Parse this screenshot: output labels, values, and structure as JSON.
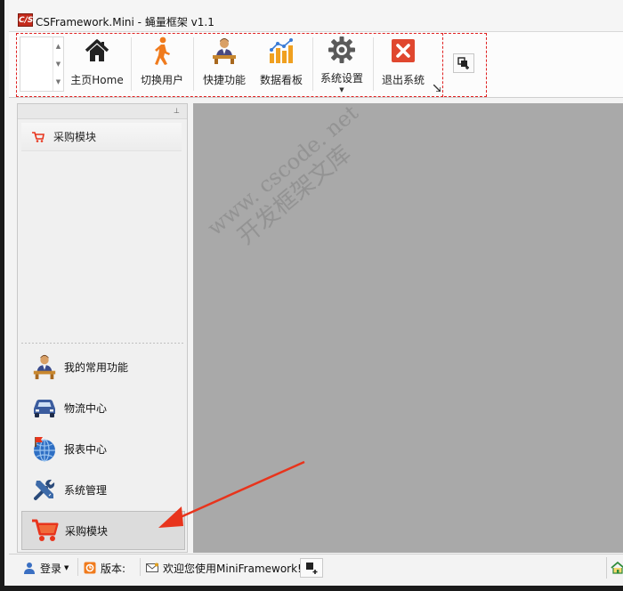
{
  "window": {
    "title": "CSFramework.Mini - 蝇量框架 v1.1",
    "logo_text": "C/S"
  },
  "ribbon": {
    "buttons": [
      {
        "label": "主页Home",
        "icon": "home-icon"
      },
      {
        "label": "切换用户",
        "icon": "walking-person-icon"
      },
      {
        "label": "快捷功能",
        "icon": "person-at-desk-icon"
      },
      {
        "label": "数据看板",
        "icon": "bar-chart-icon"
      },
      {
        "label": "系统设置",
        "icon": "gear-icon"
      },
      {
        "label": "退出系统",
        "icon": "close-icon"
      }
    ]
  },
  "nav": {
    "group_caption": "采购模块",
    "items": [
      {
        "label": "我的常用功能",
        "icon": "person-at-desk-icon"
      },
      {
        "label": "物流中心",
        "icon": "car-icon"
      },
      {
        "label": "报表中心",
        "icon": "globe-flag-icon"
      },
      {
        "label": "系统管理",
        "icon": "tools-icon"
      },
      {
        "label": "采购模块",
        "icon": "shopping-cart-icon",
        "active": true
      }
    ]
  },
  "watermark": {
    "line1": "www. cscode. net",
    "line2": "开发框架文库"
  },
  "statusbar": {
    "login_label": "登录",
    "version_label": "版本:",
    "welcome_text": "欢迎您使用MiniFramework!"
  },
  "colors": {
    "accent": "#e8341c",
    "workspace": "#a9a9a9",
    "icon_orange": "#f07b1d"
  }
}
